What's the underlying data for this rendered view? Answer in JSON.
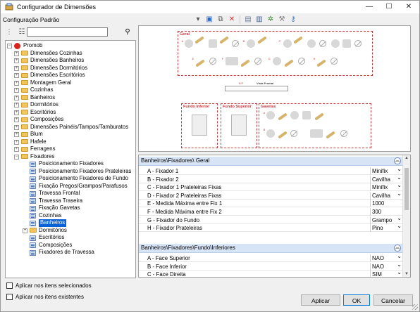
{
  "window": {
    "title": "Configurador de Dimensões",
    "minimize_icon": "minimize-icon",
    "maximize_icon": "maximize-icon",
    "close_icon": "close-icon"
  },
  "config_label": "Configuração Padrão",
  "tree": {
    "filter_value": "",
    "items": [
      {
        "label": "Promob",
        "level": 0,
        "icon": "promob-icon"
      },
      {
        "label": "Dimensões Cozinhas",
        "level": 1
      },
      {
        "label": "Dimensões Banheiros",
        "level": 1
      },
      {
        "label": "Dimensões Dormitórios",
        "level": 1
      },
      {
        "label": "Dimensões Escritórios",
        "level": 1
      },
      {
        "label": "Montagem Geral",
        "level": 1
      },
      {
        "label": "Cozinhas",
        "level": 1
      },
      {
        "label": "Banheiros",
        "level": 1
      },
      {
        "label": "Dormitórios",
        "level": 1
      },
      {
        "label": "Escritórios",
        "level": 1
      },
      {
        "label": "Composições",
        "level": 1
      },
      {
        "label": "Dimensões Painéis/Tampos/Tamburatos",
        "level": 1
      },
      {
        "label": "Blum",
        "level": 1
      },
      {
        "label": "Hafele",
        "level": 1
      },
      {
        "label": "Ferragens",
        "level": 1
      },
      {
        "label": "Fixadores",
        "level": 1
      },
      {
        "label": "Posicionamento Fixadores",
        "level": 2
      },
      {
        "label": "Posicionamento Fixadores Prateleiras",
        "level": 2
      },
      {
        "label": "Posicionamento Fixadores de Fundo",
        "level": 2
      },
      {
        "label": "Fixação Pregos/Grampos/Parafusos",
        "level": 2
      },
      {
        "label": "Travessa Frontal",
        "level": 2
      },
      {
        "label": "Travessa Traseira",
        "level": 2
      },
      {
        "label": "Fixação Gavetas",
        "level": 2
      },
      {
        "label": "Cozinhas",
        "level": 2
      },
      {
        "label": "Banheiros",
        "level": 2,
        "selected": true
      },
      {
        "label": "Dormitórios",
        "level": 2
      },
      {
        "label": "Escritórios",
        "level": 2
      },
      {
        "label": "Composições",
        "level": 2
      },
      {
        "label": "Fixadores de Travessa",
        "level": 2
      }
    ]
  },
  "options": {
    "apply_selected": "Aplicar nos itens selecionados",
    "apply_existing": "Aplicar nos itens existentes"
  },
  "preview": {
    "box_geral": "Geral",
    "box_fundo_inferior": "Fundo Inferior",
    "box_fundo_superior": "Fundo Superior",
    "box_gavetas": "Gavetas",
    "vista_frontal": "Vista Frontal"
  },
  "properties": {
    "group1": {
      "title": "Banheiros\\Fixadores\\ Geral",
      "rows": [
        {
          "name": "A - Fixador 1",
          "value": "Minifix",
          "select": true
        },
        {
          "name": "B - Fixador 2",
          "value": "Cavilha",
          "select": true
        },
        {
          "name": "C - Fixador 1 Prateleiras Fixas",
          "value": "Minifix",
          "select": true
        },
        {
          "name": "D - Fixador 2 Prateleiras Fixas",
          "value": "Cavilha",
          "select": true
        },
        {
          "name": "E - Medida Máxima entre Fix 1",
          "value": "1000",
          "select": false
        },
        {
          "name": "F - Medida Máxima entre Fix 2",
          "value": "300",
          "select": false
        },
        {
          "name": "G - Fixador do Fundo",
          "value": "Grampo",
          "select": true
        },
        {
          "name": "H - Fixador Prateleiras",
          "value": "Pino",
          "select": true
        }
      ]
    },
    "group2": {
      "title": "Banheiros\\Fixadores\\Fundo\\Inferiores",
      "rows": [
        {
          "name": "A - Face Superior",
          "value": "NAO",
          "select": true
        },
        {
          "name": "B - Face Inferior",
          "value": "NAO",
          "select": true
        },
        {
          "name": "C - Face Direita",
          "value": "SIM",
          "select": true
        }
      ]
    }
  },
  "buttons": {
    "apply": "Aplicar",
    "ok": "OK",
    "cancel": "Cancelar"
  },
  "colors": {
    "selection": "#0b62d6",
    "group_header": "#d6e4f5",
    "preview_accent": "#c8383d"
  }
}
